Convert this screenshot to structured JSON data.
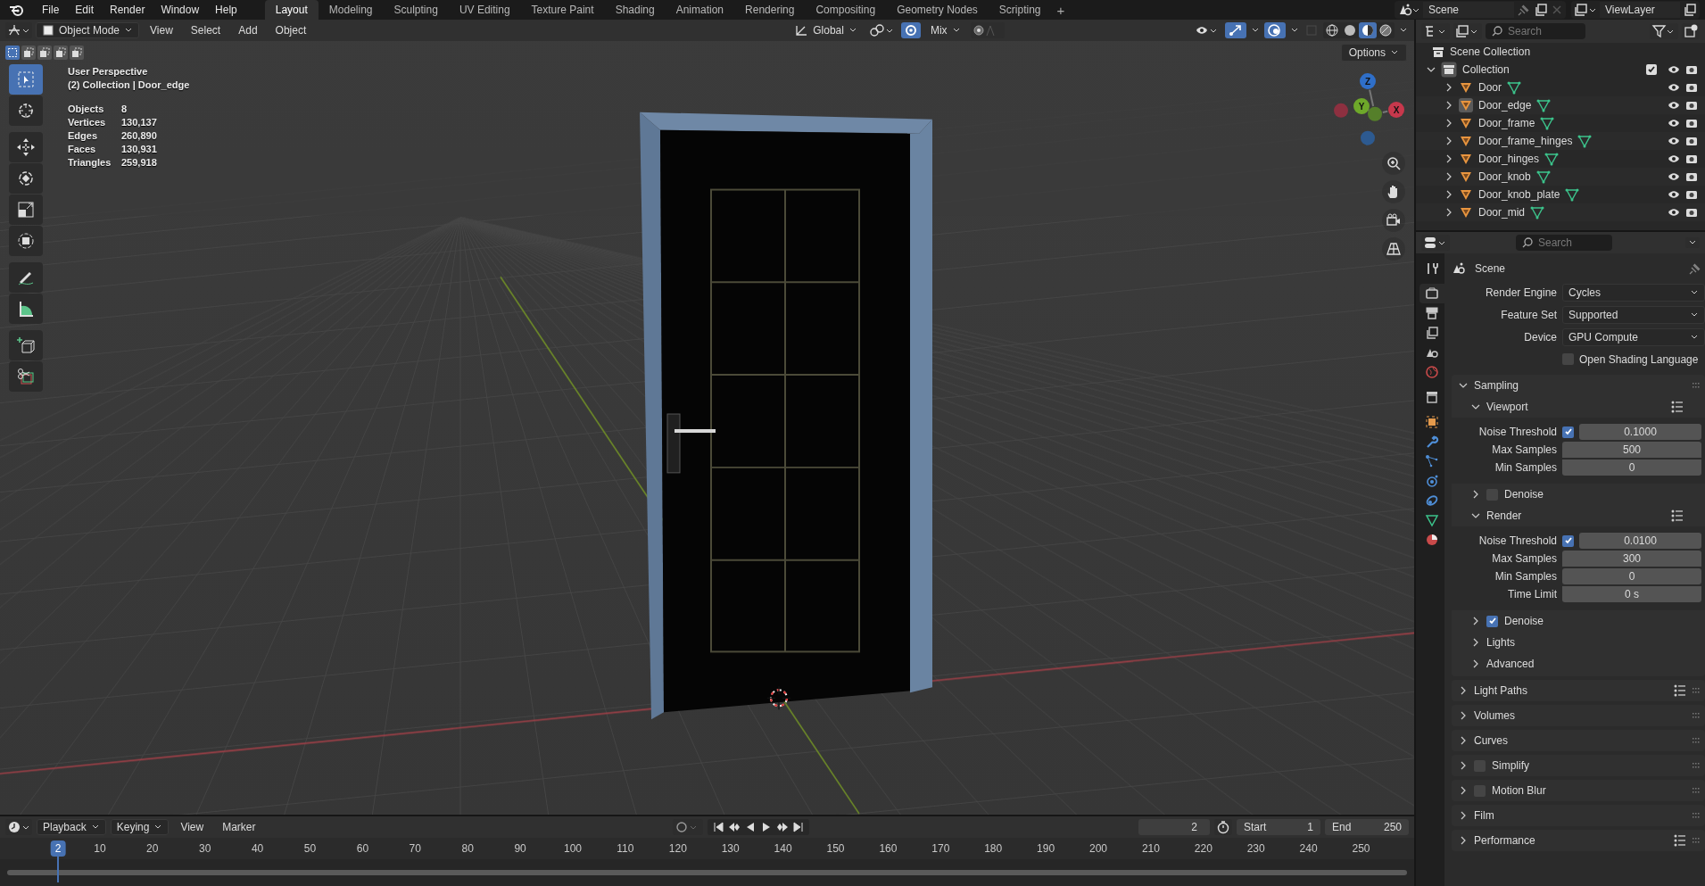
{
  "menu": [
    "File",
    "Edit",
    "Render",
    "Window",
    "Help"
  ],
  "workspaces": [
    {
      "label": "Layout",
      "selected": true
    },
    {
      "label": "Modeling",
      "selected": false
    },
    {
      "label": "Sculpting",
      "selected": false
    },
    {
      "label": "UV Editing",
      "selected": false
    },
    {
      "label": "Texture Paint",
      "selected": false
    },
    {
      "label": "Shading",
      "selected": false
    },
    {
      "label": "Animation",
      "selected": false
    },
    {
      "label": "Rendering",
      "selected": false
    },
    {
      "label": "Compositing",
      "selected": false
    },
    {
      "label": "Geometry Nodes",
      "selected": false
    },
    {
      "label": "Scripting",
      "selected": false
    }
  ],
  "add_workspace": "+",
  "scene": "Scene",
  "view_layer": "ViewLayer",
  "viewport_header": {
    "mode": "Object Mode",
    "menus": [
      "View",
      "Select",
      "Add",
      "Object"
    ],
    "orientation": "Global",
    "proportional": "Mix",
    "options": "Options"
  },
  "select_modes": [
    {
      "selected": true
    },
    {
      "selected": false
    },
    {
      "selected": false
    },
    {
      "selected": false
    },
    {
      "selected": false
    }
  ],
  "shading_modes": [
    {
      "kind": "wireframe",
      "selected": false
    },
    {
      "kind": "solid",
      "selected": false
    },
    {
      "kind": "material",
      "selected": true
    },
    {
      "kind": "rendered",
      "selected": false
    }
  ],
  "toolbar": [
    {
      "kind": "select",
      "selected": true
    },
    {
      "kind": "cursor",
      "selected": false
    },
    {
      "kind": "move",
      "selected": false
    },
    {
      "kind": "rotate",
      "selected": false
    },
    {
      "kind": "scale",
      "selected": false
    },
    {
      "kind": "transform",
      "selected": false
    },
    {
      "kind": "annotate",
      "selected": false
    },
    {
      "kind": "measure",
      "selected": false
    },
    {
      "kind": "add-cube",
      "selected": false
    },
    {
      "kind": "cut",
      "selected": false
    }
  ],
  "overlay": {
    "title": "User Perspective",
    "context": "(2) Collection | Door_edge",
    "stats": [
      {
        "label": "Objects",
        "value": "8"
      },
      {
        "label": "Vertices",
        "value": "130,137"
      },
      {
        "label": "Edges",
        "value": "260,890"
      },
      {
        "label": "Faces",
        "value": "130,931"
      },
      {
        "label": "Triangles",
        "value": "259,918"
      }
    ]
  },
  "gizmo_axes": [
    {
      "label": "Z",
      "color": "#2f6fc9"
    },
    {
      "label": "Y",
      "color": "#6ea82a"
    },
    {
      "label": "X",
      "color": "#c7384c"
    }
  ],
  "outliner": {
    "search_placeholder": "Search",
    "root": "Scene Collection",
    "collection": {
      "name": "Collection",
      "expanded": true,
      "checked": true,
      "children": [
        {
          "name": "Door",
          "selected": false
        },
        {
          "name": "Door_edge",
          "selected": true
        },
        {
          "name": "Door_frame",
          "selected": false
        },
        {
          "name": "Door_frame_hinges",
          "selected": false
        },
        {
          "name": "Door_hinges",
          "selected": false
        },
        {
          "name": "Door_knob",
          "selected": false
        },
        {
          "name": "Door_knob_plate",
          "selected": false
        },
        {
          "name": "Door_mid",
          "selected": false
        }
      ]
    }
  },
  "properties": {
    "search_placeholder": "Search",
    "tabs": [
      {
        "kind": "tool",
        "selected": false
      },
      {
        "kind": "render",
        "selected": true
      },
      {
        "kind": "output",
        "selected": false
      },
      {
        "kind": "view-layer",
        "selected": false
      },
      {
        "kind": "scene",
        "selected": false
      },
      {
        "kind": "world",
        "selected": false
      },
      {
        "kind": "collection",
        "selected": false
      },
      {
        "kind": "object",
        "selected": false
      },
      {
        "kind": "modifier",
        "selected": false
      },
      {
        "kind": "particles",
        "selected": false
      },
      {
        "kind": "physics",
        "selected": false
      },
      {
        "kind": "constraints",
        "selected": false
      },
      {
        "kind": "data",
        "selected": false
      },
      {
        "kind": "material",
        "selected": false
      }
    ],
    "context": "Scene",
    "fields": [
      {
        "label": "Render Engine",
        "value": "Cycles"
      },
      {
        "label": "Feature Set",
        "value": "Supported"
      },
      {
        "label": "Device",
        "value": "GPU Compute"
      }
    ],
    "osl": {
      "label": "Open Shading Language",
      "checked": false
    },
    "sampling": {
      "label": "Sampling",
      "expanded": true,
      "subpanels": [
        {
          "label": "Viewport",
          "expanded": true,
          "presets": true,
          "rows": [
            {
              "kind": "toggle-number",
              "label": "Noise Threshold",
              "checked": true,
              "value": "0.1000"
            },
            {
              "kind": "number",
              "label": "Max Samples",
              "value": "500"
            },
            {
              "kind": "number",
              "label": "Min Samples",
              "value": "0"
            }
          ]
        },
        {
          "label": "Denoise",
          "expanded": false,
          "checked": false
        },
        {
          "label": "Render",
          "expanded": true,
          "presets": true,
          "rows": [
            {
              "kind": "toggle-number",
              "label": "Noise Threshold",
              "checked": true,
              "value": "0.0100"
            },
            {
              "kind": "number",
              "label": "Max Samples",
              "value": "300"
            },
            {
              "kind": "number",
              "label": "Min Samples",
              "value": "0"
            },
            {
              "kind": "number",
              "label": "Time Limit",
              "value": "0 s"
            }
          ]
        },
        {
          "label": "Denoise",
          "expanded": false,
          "checked": true
        },
        {
          "label": "Lights",
          "expanded": false
        },
        {
          "label": "Advanced",
          "expanded": false
        }
      ]
    },
    "panels": [
      {
        "label": "Light Paths",
        "expanded": false,
        "presets": true
      },
      {
        "label": "Volumes",
        "expanded": false
      },
      {
        "label": "Curves",
        "expanded": false
      },
      {
        "label": "Simplify",
        "expanded": false,
        "checked": false
      },
      {
        "label": "Motion Blur",
        "expanded": false,
        "checked": false
      },
      {
        "label": "Film",
        "expanded": false
      },
      {
        "label": "Performance",
        "expanded": false,
        "presets": true
      }
    ]
  },
  "timeline": {
    "menus": [
      {
        "label": "Playback",
        "kind": "dropdown"
      },
      {
        "label": "Keying",
        "kind": "dropdown"
      },
      {
        "label": "View",
        "kind": "menu"
      },
      {
        "label": "Marker",
        "kind": "menu"
      }
    ],
    "current_frame": "2",
    "start_label": "Start",
    "start": "1",
    "end_label": "End",
    "end": "250",
    "ruler": [
      "10",
      "20",
      "30",
      "40",
      "50",
      "60",
      "70",
      "80",
      "90",
      "100",
      "110",
      "120",
      "130",
      "140",
      "150",
      "160",
      "170",
      "180",
      "190",
      "200",
      "210",
      "220",
      "230",
      "240",
      "250"
    ],
    "playhead": {
      "label": "2",
      "level": 0.008
    }
  }
}
